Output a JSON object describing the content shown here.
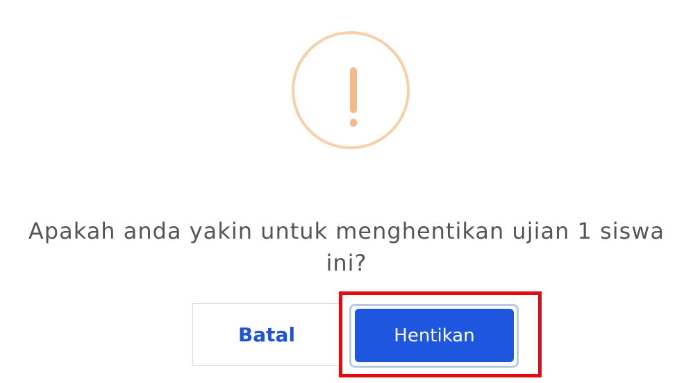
{
  "dialog": {
    "icon": "exclamation-circle-icon",
    "message_line1": "Apakah anda yakin untuk menghentikan ujian 1 siswa",
    "message_line2": "ini?",
    "buttons": {
      "cancel_label": "Batal",
      "confirm_label": "Hentikan"
    }
  },
  "colors": {
    "warning_icon": "#f6b98a",
    "primary_button": "#1f56e0",
    "cancel_text": "#1f54d6",
    "highlight": "#e30a14"
  }
}
